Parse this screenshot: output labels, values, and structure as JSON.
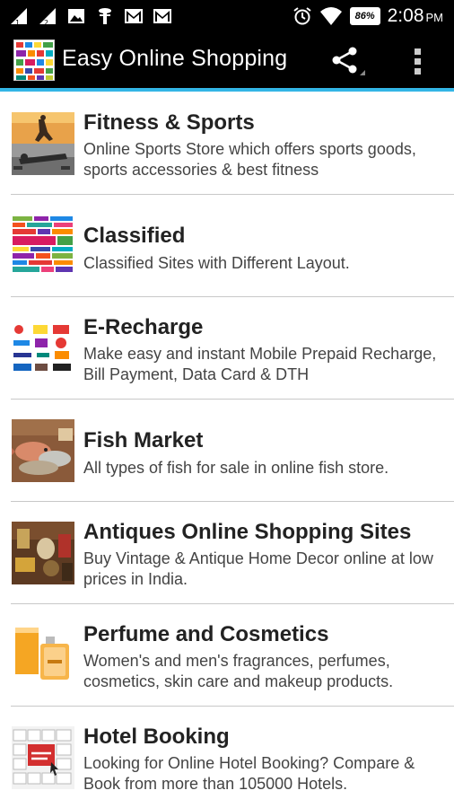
{
  "status_bar": {
    "signal1_label": "1",
    "signal2_label": "2",
    "battery": "86%",
    "time": "2:08",
    "ampm": "PM",
    "icons": [
      "signal-icon",
      "signal-icon",
      "image-icon",
      "usb-icon",
      "gmail-icon",
      "gmail-icon",
      "alarm-icon",
      "wifi-icon",
      "battery-icon"
    ]
  },
  "app_bar": {
    "title": "Easy Online Shopping",
    "actions": [
      "share-icon",
      "overflow-menu-icon"
    ],
    "accent_color": "#33b5e5"
  },
  "items": [
    {
      "title": "Fitness & Sports",
      "description": "Online Sports Store which offers sports goods, sports accessories & best fitness",
      "icon": "fitness-thumbnail"
    },
    {
      "title": "Classified",
      "description": "Classified Sites with Different Layout.",
      "icon": "classified-thumbnail"
    },
    {
      "title": "E-Recharge",
      "description": "Make easy and instant Mobile Prepaid Recharge, Bill Payment, Data Card & DTH",
      "icon": "recharge-thumbnail"
    },
    {
      "title": "Fish Market",
      "description": "All types of fish for sale in online fish store.",
      "icon": "fish-thumbnail"
    },
    {
      "title": "Antiques Online Shopping Sites",
      "description": "Buy Vintage & Antique Home Decor online at low prices in India.",
      "icon": "antiques-thumbnail"
    },
    {
      "title": "Perfume and Cosmetics",
      "description": "Women's and men's fragrances, perfumes, cosmetics, skin care and makeup products.",
      "icon": "perfume-thumbnail"
    },
    {
      "title": "Hotel Booking",
      "description": "Looking for Online Hotel Booking? Compare & Book from more than 105000 Hotels.",
      "icon": "hotel-thumbnail"
    }
  ]
}
